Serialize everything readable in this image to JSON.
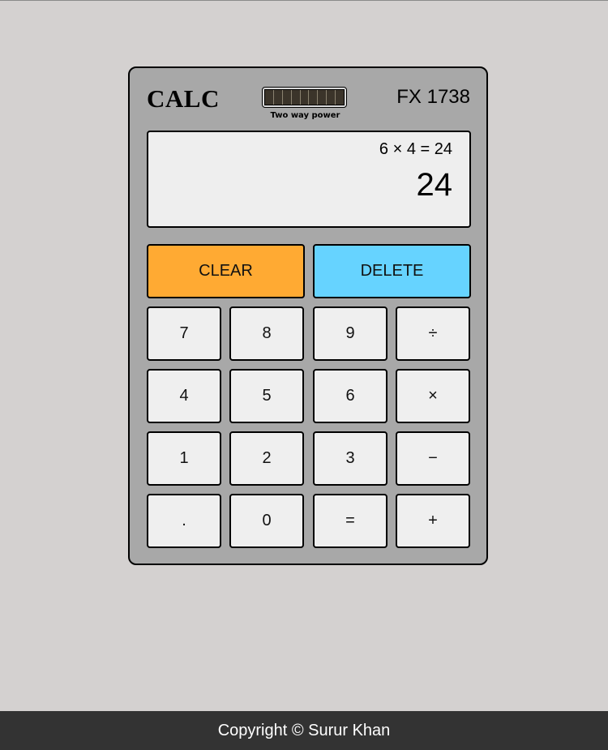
{
  "calculator": {
    "brand": "CALC",
    "model": "FX 1738",
    "solar_label": "Two way power",
    "solar_cells": 9,
    "display": {
      "expression": "6 × 4 = 24",
      "result": "24"
    },
    "actions": {
      "clear_label": "CLEAR",
      "delete_label": "DELETE"
    },
    "keys": [
      [
        "7",
        "8",
        "9",
        "÷"
      ],
      [
        "4",
        "5",
        "6",
        "×"
      ],
      [
        "1",
        "2",
        "3",
        "−"
      ],
      [
        ".",
        "0",
        "=",
        "+"
      ]
    ],
    "colors": {
      "body": "#a8a8a8",
      "clear": "#ffaa33",
      "delete": "#66d3ff",
      "key": "#efefef",
      "screen": "#eeeeee"
    }
  },
  "footer": {
    "text": "Copyright © Surur Khan"
  }
}
